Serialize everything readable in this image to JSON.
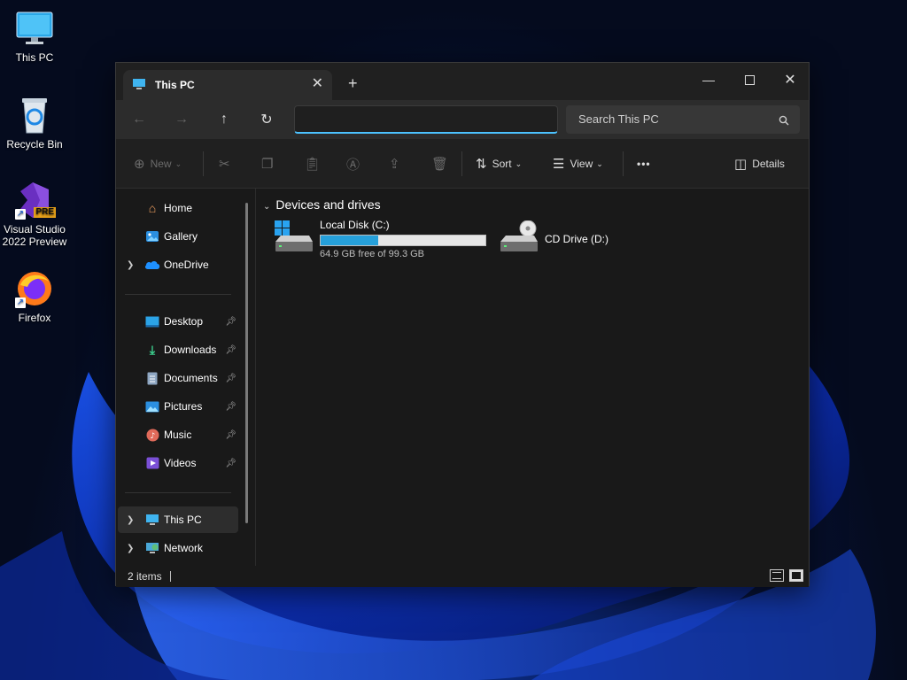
{
  "desktop": {
    "icons": [
      {
        "label": "This PC",
        "icon": "monitor-icon"
      },
      {
        "label": "Recycle Bin",
        "icon": "recycle-bin-icon"
      },
      {
        "label": "Visual Studio 2022 Preview",
        "line1": "Visual Studio",
        "line2": "2022 Preview",
        "badge": "PRE",
        "icon": "visual-studio-icon"
      },
      {
        "label": "Firefox",
        "icon": "firefox-icon"
      }
    ]
  },
  "window": {
    "tab_title": "This PC",
    "new_tab_glyph": "+",
    "address_value": "",
    "search_placeholder": "Search This PC"
  },
  "toolbar": {
    "new_label": "New",
    "sort_label": "Sort",
    "view_label": "View",
    "more_label": "•••",
    "details_label": "Details"
  },
  "sidebar": {
    "items": [
      {
        "label": "Home",
        "icon": "home-icon"
      },
      {
        "label": "Gallery",
        "icon": "gallery-icon"
      },
      {
        "label": "OneDrive",
        "icon": "onedrive-icon"
      },
      {
        "label": "Desktop",
        "icon": "desktop-folder-icon"
      },
      {
        "label": "Downloads",
        "icon": "download-icon"
      },
      {
        "label": "Documents",
        "icon": "documents-icon"
      },
      {
        "label": "Pictures",
        "icon": "pictures-icon"
      },
      {
        "label": "Music",
        "icon": "music-icon"
      },
      {
        "label": "Videos",
        "icon": "videos-icon"
      },
      {
        "label": "This PC",
        "icon": "this-pc-icon"
      },
      {
        "label": "Network",
        "icon": "network-icon"
      }
    ]
  },
  "main": {
    "group_title": "Devices and drives",
    "drives": [
      {
        "name": "Local Disk (C:)",
        "free_text": "64.9 GB free of 99.3 GB",
        "used_fraction": 0.35
      },
      {
        "name": "CD Drive (D:)"
      }
    ]
  },
  "status": {
    "item_count": "2 items"
  },
  "colors": {
    "accent": "#4cc2ff",
    "bar_fill": "#26a0da",
    "window_bg": "#191919"
  }
}
